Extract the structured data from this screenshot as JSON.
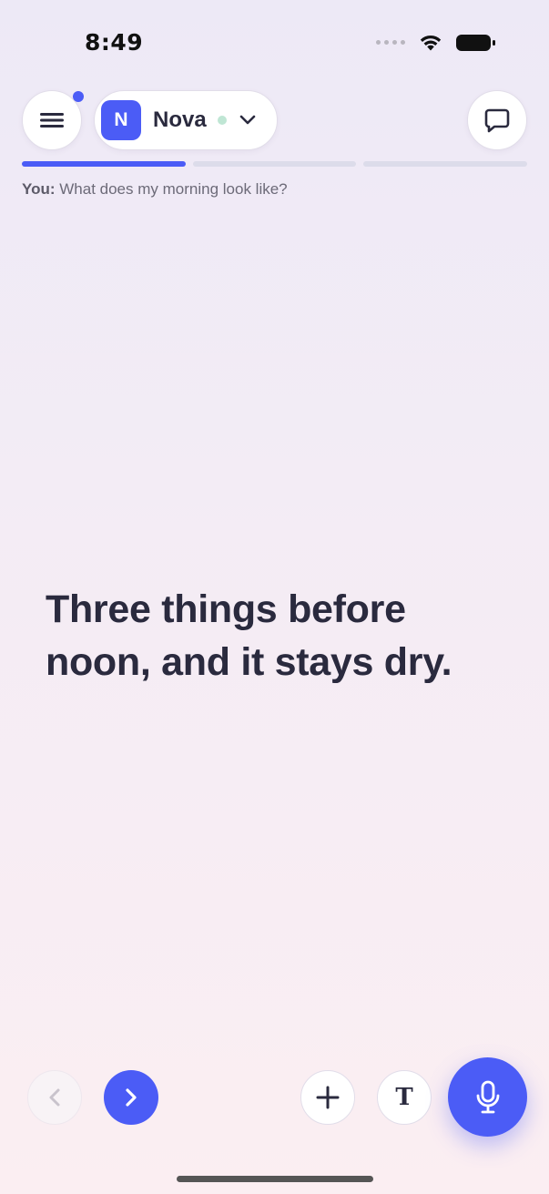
{
  "status_bar": {
    "time": "8:49"
  },
  "header": {
    "agent": {
      "initial": "N",
      "name": "Nova"
    }
  },
  "progress": {
    "segments": 3,
    "current": 1
  },
  "prompt": {
    "speaker": "You:",
    "text": "What does my morning look like?"
  },
  "answer": {
    "text": "Three things before noon, and it stays dry."
  },
  "toolbar": {
    "text_label": "T"
  },
  "colors": {
    "accent": "#4b5cf6",
    "text": "#2a2a3e",
    "online": "#bfe6d4"
  }
}
